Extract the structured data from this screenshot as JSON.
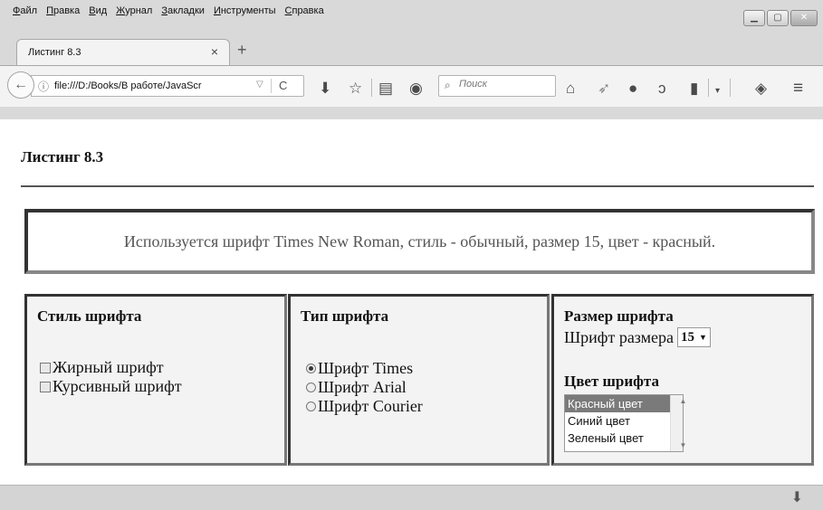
{
  "menu": [
    "Файл",
    "Правка",
    "Вид",
    "Журнал",
    "Закладки",
    "Инструменты",
    "Справка"
  ],
  "tab": {
    "title": "Листинг 8.3",
    "close": "×",
    "new": "+"
  },
  "urlbar": {
    "url": "file:///D:/Books/В работе/JavaScr",
    "info_icon": "ⓘ",
    "dropdown": "▽",
    "reload": "C"
  },
  "search": {
    "placeholder": "Поиск"
  },
  "toolbar_icons": [
    "download-icon",
    "bookmark-star-icon",
    "reading-list-icon",
    "pocket-icon",
    "home-icon",
    "send-icon",
    "chat-icon",
    "extension-icon",
    "library-icon",
    "menu-dropdown-icon",
    "addon-icon",
    "hamburger-menu-icon"
  ],
  "page": {
    "title": "Листинг 8.3",
    "info_text": "Используется шрифт Times New Roman, стиль - обычный, размер 15, цвет - красный.",
    "style_panel": {
      "heading": "Стиль шрифта",
      "options": [
        {
          "label": "Жирный шрифт",
          "checked": false
        },
        {
          "label": "Курсивный шрифт",
          "checked": false
        }
      ]
    },
    "type_panel": {
      "heading": "Тип шрифта",
      "options": [
        {
          "label": "Шрифт Times",
          "checked": true
        },
        {
          "label": "Шрифт Arial",
          "checked": false
        },
        {
          "label": "Шрифт Courier",
          "checked": false
        }
      ]
    },
    "size_panel": {
      "heading": "Размер шрифта",
      "size_label": "Шрифт размера",
      "size_value": "15",
      "color_heading": "Цвет шрифта",
      "colors": [
        "Красный цвет",
        "Синий цвет",
        "Зеленый цвет"
      ],
      "selected_color": "Красный цвет"
    }
  }
}
